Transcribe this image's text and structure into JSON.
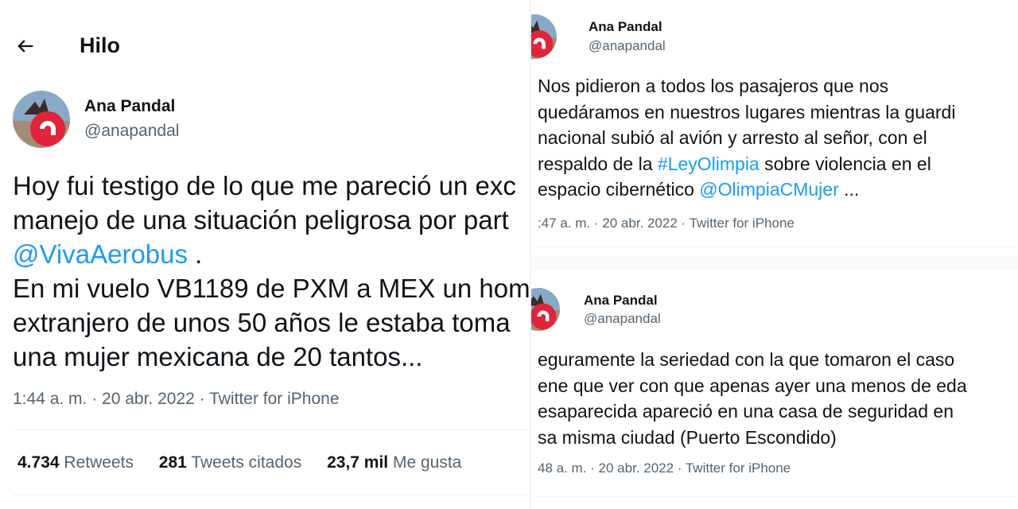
{
  "left": {
    "header_title": "Hilo",
    "author_name": "Ana Pandal",
    "author_handle": "@anapandal",
    "text": {
      "line1": "Hoy fui testigo de lo que me pareció un exc",
      "line2": "manejo de una situación peligrosa por part",
      "mention": "@VivaAerobus",
      "line3_tail": " .",
      "line4": "En mi vuelo VB1189 de PXM a MEX un hom",
      "line5": "extranjero de unos 50 años le estaba toma",
      "line6": "una mujer mexicana de 20 tantos..."
    },
    "meta": "1:44 a. m. · 20 abr. 2022 · Twitter for iPhone",
    "stats": [
      {
        "value": "4.734",
        "label": "Retweets"
      },
      {
        "value": "281",
        "label": "Tweets citados"
      },
      {
        "value": "23,7 mil",
        "label": "Me gusta"
      }
    ]
  },
  "right_top": {
    "author_name": "Ana Pandal",
    "author_handle": "@anapandal",
    "text": {
      "line1": "Nos pidieron a todos los pasajeros que nos",
      "line2": "quedáramos en nuestros lugares mientras la guardi",
      "line3": "nacional subió al avión y arresto al señor, con el",
      "line4_a": "respaldo de la ",
      "line4_hashtag": "#LeyOlimpia",
      "line4_b": " sobre violencia en el",
      "line5_a": "espacio cibernético ",
      "line5_mention": "@OlimpiaCMujer",
      "line5_b": " ..."
    },
    "meta": ":47 a. m. · 20 abr. 2022 · Twitter for iPhone"
  },
  "right_bottom": {
    "author_name": "Ana Pandal",
    "author_handle": "@anapandal",
    "text": {
      "line1": "eguramente la seriedad con la que tomaron el caso",
      "line2": "ene que ver con que apenas ayer una menos de eda",
      "line3": "esaparecida apareció en una casa de seguridad en",
      "line4": "sa misma ciudad (Puerto Escondido)"
    },
    "meta": "48 a. m. · 20 abr. 2022 · Twitter for iPhone"
  },
  "colors": {
    "link": "#1d9bf0",
    "secondary_text": "#536471",
    "primary_text": "#0f1419"
  },
  "icons": {
    "back": "arrow-left-icon",
    "avatar": "avatar"
  }
}
